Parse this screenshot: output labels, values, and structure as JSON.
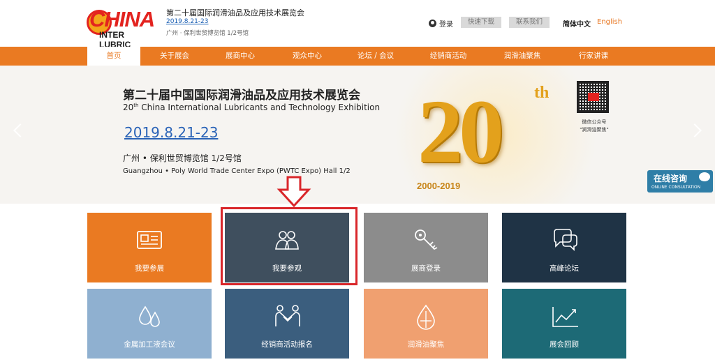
{
  "header": {
    "logo_text_top": "CHINA",
    "logo_text_bottom": "INTER LUBRIC",
    "title": "第二十届国际润滑油品及应用技术展览会",
    "date_link": "2019.8.21-23",
    "venue": "广州 · 保利世贸博览馆 1/2号馆",
    "login": "登录",
    "quick_download": "快速下载",
    "contact_us": "联系我们",
    "lang_cn": "简体中文",
    "lang_en": "English"
  },
  "nav": {
    "items": [
      "首页",
      "关于展会",
      "展商中心",
      "观众中心",
      "论坛 / 会议",
      "经销商活动",
      "润滑油聚焦",
      "行家讲课"
    ],
    "active_index": 0
  },
  "banner": {
    "title_cn": "第二十届中国国际润滑油品及应用技术展览会",
    "title_en_num": "20",
    "title_en_sup": "th",
    "title_en_rest": " China International Lubricants and Technology Exhibition",
    "date": "2019.8.21-23",
    "venue_cn": "广州 • 保利世贸博览馆 1/2号馆",
    "venue_en": "Guangzhou • Poly World Trade Center Expo (PWTC Expo) Hall 1/2",
    "big_number": "20",
    "big_suffix": "th",
    "years": "2000-2019",
    "qr_caption_1": "微信公众号",
    "qr_caption_2": "\"润滑油聚焦\"",
    "qr_badge_icon": "qr-code-icon"
  },
  "consult": {
    "title": "在线咨询",
    "subtitle": "ONLINE CONSULTATION"
  },
  "tiles": [
    {
      "label": "我要参展",
      "color": "#ea7a22",
      "icon": "id-card-icon"
    },
    {
      "label": "我要参观",
      "color": "#3f4f5e",
      "icon": "visitors-icon"
    },
    {
      "label": "展商登录",
      "color": "#8c8c8c",
      "icon": "key-icon"
    },
    {
      "label": "高峰论坛",
      "color": "#1f3345",
      "icon": "chat-bubbles-icon"
    },
    {
      "label": "金属加工液会议",
      "color": "#8fb0d0",
      "icon": "droplets-icon"
    },
    {
      "label": "经销商活动报名",
      "color": "#3b5e7e",
      "icon": "handshake-icon"
    },
    {
      "label": "润滑油聚焦",
      "color": "#f0a070",
      "icon": "oil-drop-icon"
    },
    {
      "label": "展会回顾",
      "color": "#1d6a76",
      "icon": "line-chart-icon"
    }
  ]
}
